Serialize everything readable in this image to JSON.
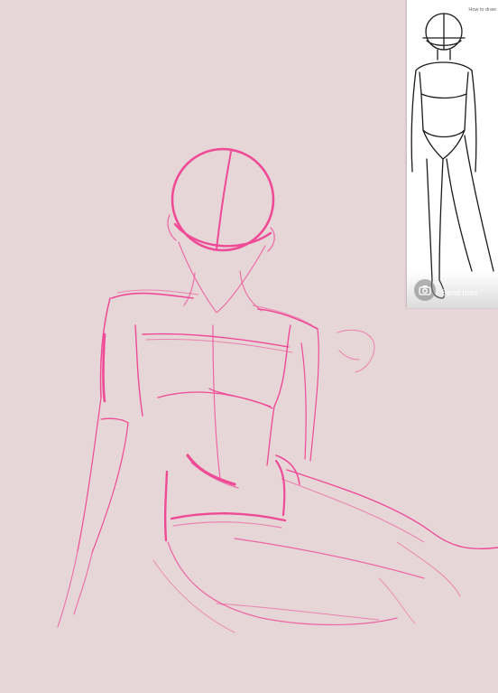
{
  "reference": {
    "title": "How to draw",
    "send_placeholder": "Send mes",
    "camera_icon": "camera-icon"
  },
  "colors": {
    "canvas_bg": "#e6d6d8",
    "sketch_stroke": "#ef4a96",
    "sketch_light": "#f07ab0"
  }
}
